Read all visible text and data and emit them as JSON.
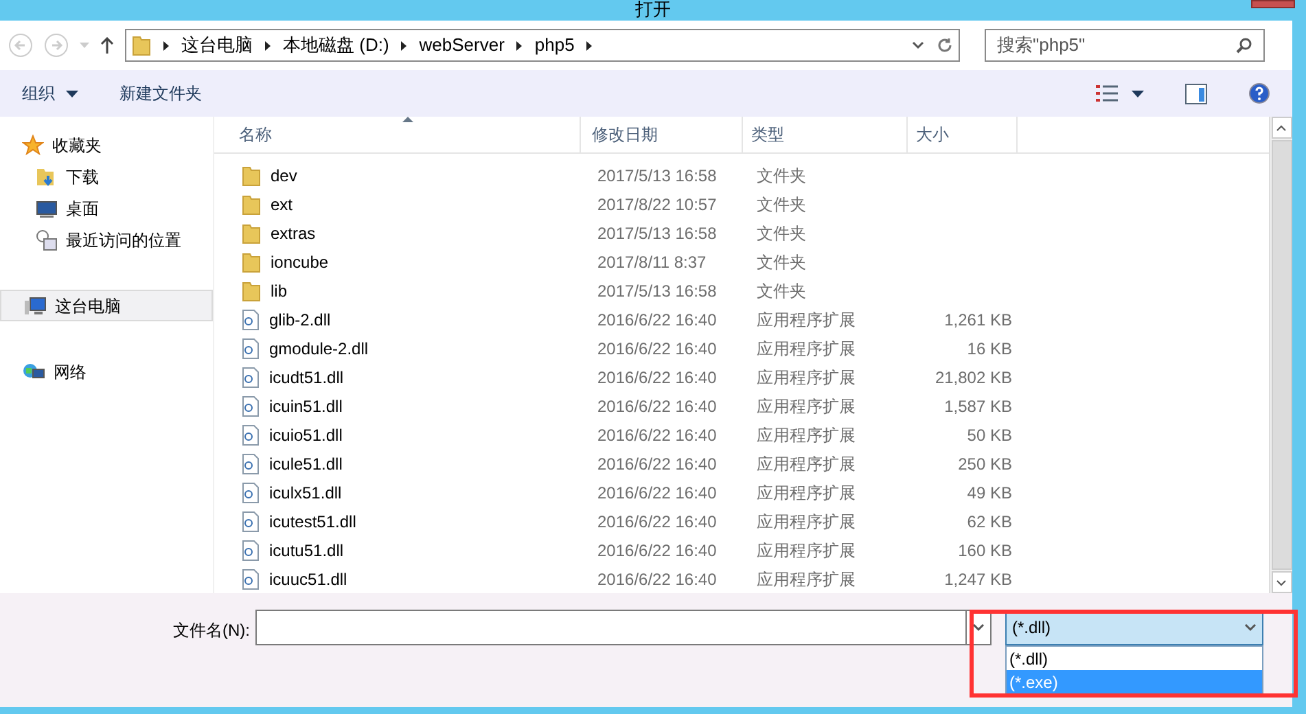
{
  "window": {
    "title": "打开"
  },
  "breadcrumb": [
    "这台电脑",
    "本地磁盘 (D:)",
    "webServer",
    "php5"
  ],
  "search": {
    "placeholder": "搜索\"php5\""
  },
  "toolbar": {
    "organize": "组织",
    "new_folder": "新建文件夹"
  },
  "sidebar": {
    "items": [
      {
        "label": "收藏夹",
        "kind": "star",
        "selected": false,
        "children": [
          {
            "label": "下载",
            "kind": "download",
            "selected": false
          },
          {
            "label": "桌面",
            "kind": "desktop",
            "selected": false
          },
          {
            "label": "最近访问的位置",
            "kind": "recent",
            "selected": false
          }
        ]
      },
      {
        "label": "这台电脑",
        "kind": "computer",
        "selected": true
      },
      {
        "label": "网络",
        "kind": "network",
        "selected": false
      }
    ]
  },
  "table": {
    "columns": [
      "名称",
      "修改日期",
      "类型",
      "大小"
    ],
    "rows": [
      {
        "kind": "folder",
        "name": "dev",
        "date": "2017/5/13 16:58",
        "type": "文件夹",
        "size": ""
      },
      {
        "kind": "folder",
        "name": "ext",
        "date": "2017/8/22 10:57",
        "type": "文件夹",
        "size": ""
      },
      {
        "kind": "folder",
        "name": "extras",
        "date": "2017/5/13 16:58",
        "type": "文件夹",
        "size": ""
      },
      {
        "kind": "folder",
        "name": "ioncube",
        "date": "2017/8/11 8:37",
        "type": "文件夹",
        "size": ""
      },
      {
        "kind": "folder",
        "name": "lib",
        "date": "2017/5/13 16:58",
        "type": "文件夹",
        "size": ""
      },
      {
        "kind": "file",
        "name": "glib-2.dll",
        "date": "2016/6/22 16:40",
        "type": "应用程序扩展",
        "size": "1,261 KB"
      },
      {
        "kind": "file",
        "name": "gmodule-2.dll",
        "date": "2016/6/22 16:40",
        "type": "应用程序扩展",
        "size": "16 KB"
      },
      {
        "kind": "file",
        "name": "icudt51.dll",
        "date": "2016/6/22 16:40",
        "type": "应用程序扩展",
        "size": "21,802 KB"
      },
      {
        "kind": "file",
        "name": "icuin51.dll",
        "date": "2016/6/22 16:40",
        "type": "应用程序扩展",
        "size": "1,587 KB"
      },
      {
        "kind": "file",
        "name": "icuio51.dll",
        "date": "2016/6/22 16:40",
        "type": "应用程序扩展",
        "size": "50 KB"
      },
      {
        "kind": "file",
        "name": "icule51.dll",
        "date": "2016/6/22 16:40",
        "type": "应用程序扩展",
        "size": "250 KB"
      },
      {
        "kind": "file",
        "name": "iculx51.dll",
        "date": "2016/6/22 16:40",
        "type": "应用程序扩展",
        "size": "49 KB"
      },
      {
        "kind": "file",
        "name": "icutest51.dll",
        "date": "2016/6/22 16:40",
        "type": "应用程序扩展",
        "size": "62 KB"
      },
      {
        "kind": "file",
        "name": "icutu51.dll",
        "date": "2016/6/22 16:40",
        "type": "应用程序扩展",
        "size": "160 KB"
      },
      {
        "kind": "file",
        "name": "icuuc51.dll",
        "date": "2016/6/22 16:40",
        "type": "应用程序扩展",
        "size": "1,247 KB"
      }
    ]
  },
  "filename": {
    "label": "文件名(N):"
  },
  "filetype": {
    "value": "(*.dll)",
    "options": [
      {
        "label": "(*.dll)",
        "highlighted": false
      },
      {
        "label": "(*.exe)",
        "highlighted": true
      }
    ]
  }
}
